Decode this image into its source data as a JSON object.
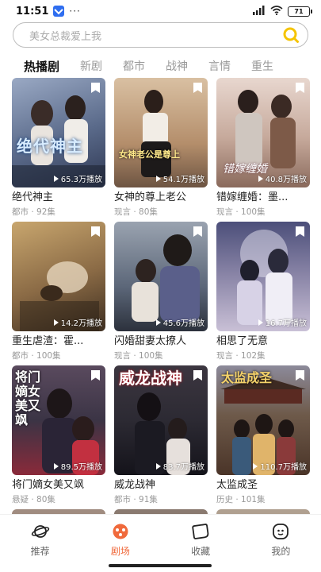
{
  "status_bar": {
    "time": "11:51",
    "dots": "···",
    "network": "4G",
    "battery": "71"
  },
  "search": {
    "placeholder": "美女总裁爱上我"
  },
  "tabs": [
    {
      "label": "热播剧",
      "active": true
    },
    {
      "label": "新剧",
      "active": false
    },
    {
      "label": "都市",
      "active": false
    },
    {
      "label": "战神",
      "active": false
    },
    {
      "label": "言情",
      "active": false
    },
    {
      "label": "重生",
      "active": false
    }
  ],
  "dramas": [
    {
      "title": "绝代神主",
      "genre": "都市",
      "episodes": "92集",
      "meta": "都市 · 92集",
      "plays": "65.3万播放",
      "poster_color": "#6f7fa0"
    },
    {
      "title": "女神的尊上老公",
      "genre": "现言",
      "episodes": "80集",
      "meta": "现言 · 80集",
      "plays": "54.1万播放",
      "poster_color": "#b38a6b"
    },
    {
      "title": "错嫁缠婚：墨...",
      "genre": "现言",
      "episodes": "100集",
      "meta": "现言 · 100集",
      "plays": "40.8万播放",
      "poster_color": "#c6a99b"
    },
    {
      "title": "重生虐渣：霍...",
      "genre": "都市",
      "episodes": "100集",
      "meta": "都市 · 100集",
      "plays": "14.2万播放",
      "poster_color": "#8a6a45"
    },
    {
      "title": "闪婚甜妻太撩人",
      "genre": "现言",
      "episodes": "100集",
      "meta": "现言 · 100集",
      "plays": "45.6万播放",
      "poster_color": "#5b6678"
    },
    {
      "title": "相思了无意",
      "genre": "现言",
      "episodes": "102集",
      "meta": "现言 · 102集",
      "plays": "16.7万播放",
      "poster_color": "#8b86a8"
    },
    {
      "title": "将门嫡女美又飒",
      "genre": "悬疑",
      "episodes": "80集",
      "meta": "悬疑 · 80集",
      "plays": "89.5万播放",
      "poster_color": "#3b3445"
    },
    {
      "title": "威龙战神",
      "genre": "都市",
      "episodes": "91集",
      "meta": "都市 · 91集",
      "plays": "83.7万播放",
      "poster_color": "#2c2a33"
    },
    {
      "title": "太监成圣",
      "genre": "历史",
      "episodes": "101集",
      "meta": "历史 · 101集",
      "plays": "110.7万播放",
      "poster_color": "#6e5a4a"
    }
  ],
  "poster_overlays": {
    "d0": "绝代神主",
    "d1": "女神老公是尊上",
    "d2": "错嫁缠婚",
    "d6": "将门嫡女美又飒",
    "d7": "威龙战神",
    "d8": "太监成圣"
  },
  "bottom_nav": [
    {
      "label": "推荐",
      "icon": "planet-icon",
      "active": false
    },
    {
      "label": "剧场",
      "icon": "theater-icon",
      "active": true
    },
    {
      "label": "收藏",
      "icon": "collection-icon",
      "active": false
    },
    {
      "label": "我的",
      "icon": "profile-icon",
      "active": false
    }
  ],
  "colors": {
    "accent": "#f06a3c",
    "search_icon": "#f5c400",
    "tab_active": "#111111",
    "tab_inactive": "#999999"
  }
}
